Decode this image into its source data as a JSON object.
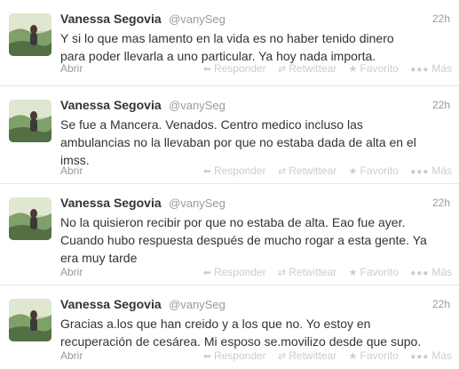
{
  "tweets": [
    {
      "fullname": "Vanessa Segovia",
      "username": "@vanySeg",
      "time": "22h",
      "lines": [
        "Y si lo que mas lamento en la vida es no haber tenido dinero",
        "para poder llevarla a uno particular.  Ya hoy nada importa."
      ],
      "expand": "Abrir",
      "actions": {
        "reply": "Responder",
        "retweet": "Retwittear",
        "favorite": "Favorito",
        "more": "Más"
      }
    },
    {
      "fullname": "Vanessa Segovia",
      "username": "@vanySeg",
      "time": "22h",
      "lines": [
        "Se fue a Mancera. Venados. Centro medico incluso las",
        "ambulancias no la llevaban por que no estaba dada de alta en el",
        "imss."
      ],
      "expand": "Abrir",
      "actions": {
        "reply": "Responder",
        "retweet": "Retwittear",
        "favorite": "Favorito",
        "more": "Más"
      }
    },
    {
      "fullname": "Vanessa Segovia",
      "username": "@vanySeg",
      "time": "22h",
      "lines": [
        "No la quisieron recibir por que no estaba de alta. Eao fue ayer.",
        "Cuando hubo respuesta después de mucho rogar a esta gente. Ya",
        "era muy tarde"
      ],
      "expand": "Abrir",
      "actions": {
        "reply": "Responder",
        "retweet": "Retwittear",
        "favorite": "Favorito",
        "more": "Más"
      }
    },
    {
      "fullname": "Vanessa Segovia",
      "username": "@vanySeg",
      "time": "22h",
      "lines": [
        "Gracias a.los que han creido y a los que no. Yo estoy en",
        "recuperación de cesárea.  Mi esposo se.movilizo desde que supo."
      ],
      "expand": "Abrir",
      "actions": {
        "reply": "Responder",
        "retweet": "Retwittear",
        "favorite": "Favorito",
        "more": "Más"
      }
    }
  ],
  "icons": {
    "reply": "reply-arrow-icon",
    "retweet": "retweet-icon",
    "favorite": "star-icon",
    "more": "ellipsis-icon"
  },
  "colors": {
    "name": "#333333",
    "meta": "#999999",
    "action": "#cccccc",
    "divider": "#e8e8e8"
  }
}
